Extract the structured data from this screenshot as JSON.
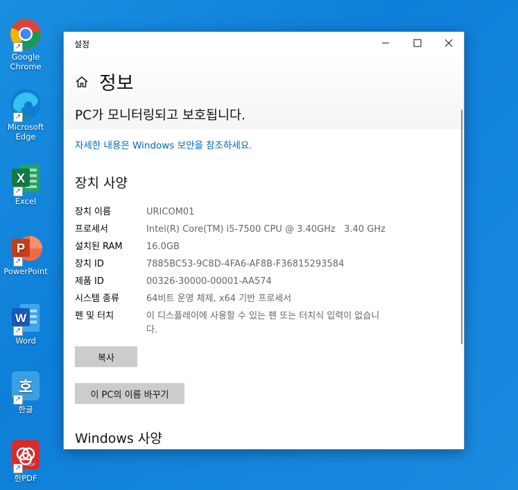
{
  "desktop": {
    "icons": [
      {
        "label1": "Google",
        "label2": "Chrome"
      },
      {
        "label1": "Microsoft",
        "label2": "Edge"
      },
      {
        "label1": "Excel",
        "label2": ""
      },
      {
        "label1": "PowerPoint",
        "label2": ""
      },
      {
        "label1": "Word",
        "label2": ""
      },
      {
        "label1": "한글",
        "label2": ""
      },
      {
        "label1": "한PDF",
        "label2": ""
      }
    ]
  },
  "window": {
    "title": "설정",
    "controls": {
      "minimize": "—",
      "maximize": "☐",
      "close": "✕"
    },
    "page_title": "정보",
    "protect_text": "PC가 모니터링되고 보호됩니다.",
    "security_link": "자세한 내용은 Windows 보안을 참조하세요.",
    "device_specs_heading": "장치 사양",
    "specs": [
      {
        "label": "장치 이름",
        "value": "URICOM01"
      },
      {
        "label": "프로세서",
        "value": "Intel(R) Core(TM) i5-7500 CPU @ 3.40GHz   3.40 GHz"
      },
      {
        "label": "설치된 RAM",
        "value": "16.0GB"
      },
      {
        "label": "장치 ID",
        "value": "7885BC53-9C8D-4FA6-AF8B-F36815293584"
      },
      {
        "label": "제품 ID",
        "value": "00326-30000-00001-AA574"
      },
      {
        "label": "시스템 종류",
        "value": "64비트 운영 체제, x64 기반 프로세서"
      },
      {
        "label": "펜 및 터치",
        "value": "이 디스플레이에 사용할 수 있는 펜 또는 터치식 입력이 없습니다."
      }
    ],
    "copy_button": "복사",
    "rename_button": "이 PC의 이름 바꾸기",
    "windows_specs_heading": "Windows 사양"
  }
}
